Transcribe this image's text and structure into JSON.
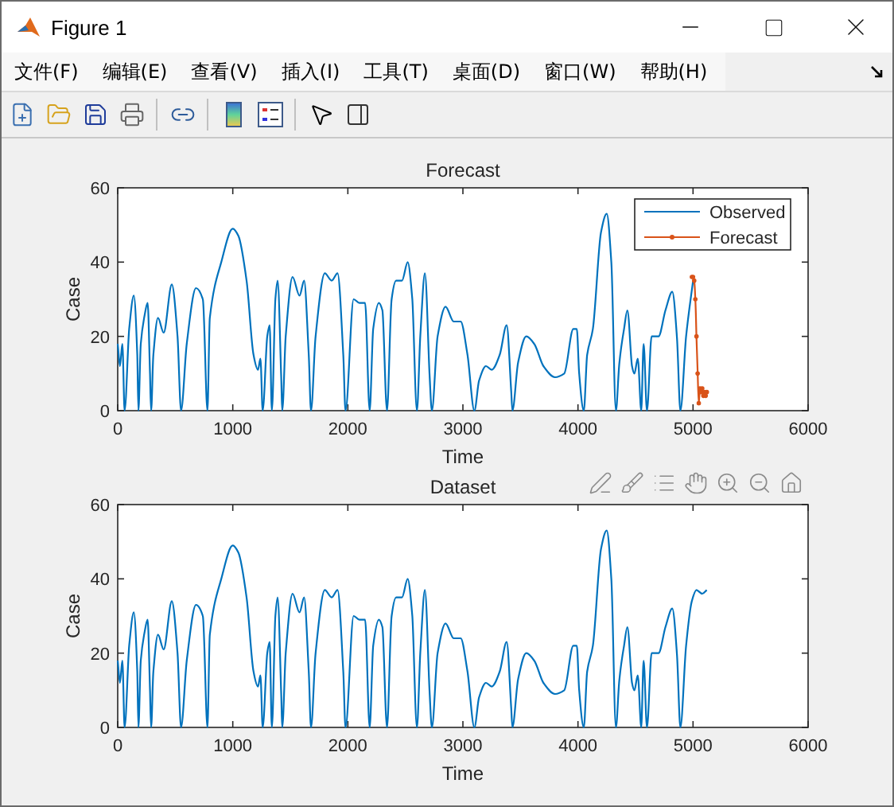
{
  "window": {
    "title": "Figure 1"
  },
  "menu": [
    {
      "label": "文件(F)"
    },
    {
      "label": "编辑(E)"
    },
    {
      "label": "查看(V)"
    },
    {
      "label": "插入(I)"
    },
    {
      "label": "工具(T)"
    },
    {
      "label": "桌面(D)"
    },
    {
      "label": "窗口(W)"
    },
    {
      "label": "帮助(H)"
    }
  ],
  "charts": [
    {
      "chart_data": {
        "legend": true,
        "type": "line",
        "title": "Forecast",
        "xlabel": "Time",
        "ylabel": "Case",
        "xlim": [
          0,
          6000
        ],
        "ylim": [
          0,
          60
        ],
        "xticks": [
          0,
          1000,
          2000,
          3000,
          4000,
          5000,
          6000
        ],
        "yticks": [
          0,
          20,
          40,
          60
        ],
        "series": [
          {
            "name": "Observed",
            "color": "#0072bd",
            "x": [
              0,
              20,
              40,
              60,
              100,
              140,
              170,
              180,
              200,
              230,
              260,
              280,
              290,
              310,
              350,
              400,
              470,
              520,
              550,
              600,
              680,
              740,
              780,
              800,
              900,
              1000,
              1050,
              1120,
              1180,
              1220,
              1240,
              1260,
              1300,
              1320,
              1340,
              1370,
              1390,
              1420,
              1430,
              1460,
              1520,
              1580,
              1620,
              1660,
              1680,
              1720,
              1800,
              1860,
              1910,
              1960,
              1980,
              2050,
              2100,
              2150,
              2190,
              2220,
              2270,
              2300,
              2340,
              2380,
              2420,
              2470,
              2520,
              2560,
              2600,
              2630,
              2670,
              2710,
              2730,
              2780,
              2850,
              2920,
              2980,
              3040,
              3100,
              3140,
              3200,
              3250,
              3320,
              3380,
              3420,
              3430,
              3480,
              3550,
              3620,
              3700,
              3800,
              3880,
              3960,
              3990,
              4010,
              4050,
              4080,
              4130,
              4200,
              4250,
              4290,
              4330,
              4360,
              4400,
              4430,
              4470,
              4490,
              4520,
              4550,
              4570,
              4600,
              4640,
              4700,
              4760,
              4820,
              4860,
              4890,
              4940,
              5000
            ],
            "values": [
              18,
              12,
              18,
              0,
              22,
              31,
              15,
              0,
              18,
              25,
              29,
              10,
              0,
              15,
              25,
              21,
              34,
              20,
              0,
              18,
              33,
              30,
              0,
              25,
              40,
              49,
              47,
              35,
              15,
              11,
              14,
              0,
              20,
              23,
              0,
              30,
              35,
              10,
              0,
              20,
              36,
              31,
              35,
              15,
              0,
              20,
              37,
              35,
              37,
              15,
              0,
              30,
              29,
              29,
              0,
              22,
              29,
              27,
              0,
              30,
              35,
              35,
              40,
              30,
              0,
              20,
              37,
              10,
              0,
              20,
              28,
              24,
              24,
              15,
              0,
              8,
              12,
              11,
              15,
              23,
              5,
              0,
              13,
              20,
              18,
              12,
              9,
              10,
              22,
              22,
              10,
              0,
              15,
              22,
              48,
              53,
              40,
              0,
              13,
              22,
              27,
              12,
              10,
              14,
              0,
              18,
              0,
              20,
              20,
              27,
              32,
              20,
              0,
              20,
              35
            ]
          },
          {
            "name": "Forecast",
            "color": "#d95319",
            "x": [
              4990,
              5000,
              5010,
              5020,
              5030,
              5040,
              5050,
              5060,
              5070,
              5080,
              5090,
              5100,
              5110,
              5120
            ],
            "values": [
              36,
              36,
              35,
              30,
              20,
              10,
              2,
              6,
              5,
              6,
              4,
              5,
              4,
              5
            ]
          }
        ]
      }
    },
    {
      "chart_data": {
        "type": "line",
        "title": "Dataset",
        "xlabel": "Time",
        "ylabel": "Case",
        "xlim": [
          0,
          6000
        ],
        "ylim": [
          0,
          60
        ],
        "xticks": [
          0,
          1000,
          2000,
          3000,
          4000,
          5000,
          6000
        ],
        "yticks": [
          0,
          20,
          40,
          60
        ],
        "series": [
          {
            "color": "#0072bd",
            "x": [
              0,
              20,
              40,
              60,
              100,
              140,
              170,
              180,
              200,
              230,
              260,
              280,
              290,
              310,
              350,
              400,
              470,
              520,
              550,
              600,
              680,
              740,
              780,
              800,
              900,
              1000,
              1050,
              1120,
              1180,
              1220,
              1240,
              1260,
              1300,
              1320,
              1340,
              1370,
              1390,
              1420,
              1430,
              1460,
              1520,
              1580,
              1620,
              1660,
              1680,
              1720,
              1800,
              1860,
              1910,
              1960,
              1980,
              2050,
              2100,
              2150,
              2190,
              2220,
              2270,
              2300,
              2340,
              2380,
              2420,
              2470,
              2520,
              2560,
              2600,
              2630,
              2670,
              2710,
              2730,
              2780,
              2850,
              2920,
              2980,
              3040,
              3100,
              3140,
              3200,
              3250,
              3320,
              3380,
              3420,
              3430,
              3480,
              3550,
              3620,
              3700,
              3800,
              3880,
              3960,
              3990,
              4010,
              4050,
              4080,
              4130,
              4200,
              4250,
              4290,
              4330,
              4360,
              4400,
              4430,
              4470,
              4490,
              4520,
              4550,
              4570,
              4600,
              4640,
              4700,
              4760,
              4820,
              4860,
              4890,
              4940,
              4990,
              5030,
              5080,
              5120
            ],
            "values": [
              18,
              12,
              18,
              0,
              22,
              31,
              15,
              0,
              18,
              25,
              29,
              10,
              0,
              15,
              25,
              21,
              34,
              20,
              0,
              18,
              33,
              30,
              0,
              25,
              40,
              49,
              47,
              35,
              15,
              11,
              14,
              0,
              20,
              23,
              0,
              30,
              35,
              10,
              0,
              20,
              36,
              31,
              35,
              15,
              0,
              20,
              37,
              35,
              37,
              15,
              0,
              30,
              29,
              29,
              0,
              22,
              29,
              27,
              0,
              30,
              35,
              35,
              40,
              30,
              0,
              20,
              37,
              10,
              0,
              20,
              28,
              24,
              24,
              15,
              0,
              8,
              12,
              11,
              15,
              23,
              5,
              0,
              13,
              20,
              18,
              12,
              9,
              10,
              22,
              22,
              10,
              0,
              15,
              22,
              48,
              53,
              40,
              0,
              13,
              22,
              27,
              12,
              10,
              14,
              0,
              18,
              0,
              20,
              20,
              27,
              32,
              20,
              0,
              22,
              34,
              37,
              36,
              37
            ]
          }
        ]
      }
    }
  ]
}
